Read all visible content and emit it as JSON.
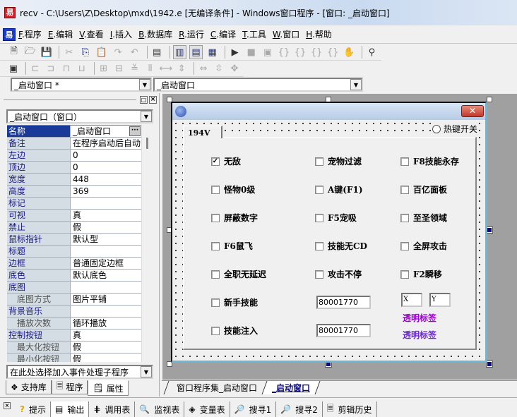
{
  "window": {
    "title": "recv - C:\\Users\\Z\\Desktop\\mxd\\1942.e [无编译条件] - Windows窗口程序 - [窗口: _启动窗口]",
    "app_icon": "easy-language-logo"
  },
  "menu": [
    {
      "key": "F",
      "label": ".程序"
    },
    {
      "key": "E",
      "label": ".编辑"
    },
    {
      "key": "V",
      "label": ".查看"
    },
    {
      "key": "I",
      "label": ".插入"
    },
    {
      "key": "B",
      "label": ".数据库"
    },
    {
      "key": "R",
      "label": ".运行"
    },
    {
      "key": "C",
      "label": ".编译"
    },
    {
      "key": "T",
      "label": ".工具"
    },
    {
      "key": "W",
      "label": ".窗口"
    },
    {
      "key": "H",
      "label": ".帮助"
    }
  ],
  "toolbar1": {
    "icons": [
      "new-file",
      "open-folder",
      "save",
      "cut",
      "copy",
      "paste",
      "redo",
      "undo",
      "find-window",
      "layout-1",
      "layout-2",
      "layout-3",
      "run",
      "stop",
      "compile",
      "step-into",
      "step-over",
      "step-out",
      "run-to-cursor",
      "breakpoint-hand",
      "find-binoculars"
    ]
  },
  "toolbar2": {
    "icons": [
      "form-layout",
      "align-left",
      "align-right",
      "align-top",
      "align-bottom",
      "center-horizontal",
      "center-vertical",
      "distribute-top",
      "distribute-left",
      "space-horizontal",
      "space-vertical",
      "same-width",
      "same-height",
      "same-size"
    ]
  },
  "combos": {
    "left": "_启动窗口 *",
    "right": "_启动窗口"
  },
  "left_panel": {
    "object_select": "_启动窗口（窗口）",
    "properties": [
      {
        "name": "名称",
        "value": "_启动窗口",
        "selected": true,
        "ellipsis": true
      },
      {
        "name": "备注",
        "value": "在程序启动后自动"
      },
      {
        "name": "左边",
        "value": "0"
      },
      {
        "name": "顶边",
        "value": "0"
      },
      {
        "name": "宽度",
        "value": "448"
      },
      {
        "name": "高度",
        "value": "369"
      },
      {
        "name": "标记",
        "value": ""
      },
      {
        "name": "可视",
        "value": "真"
      },
      {
        "name": "禁止",
        "value": "假"
      },
      {
        "name": "鼠标指针",
        "value": "默认型"
      },
      {
        "name": "标题",
        "value": ""
      },
      {
        "name": "边框",
        "value": "普通固定边框"
      },
      {
        "name": "底色",
        "value": "默认底色"
      },
      {
        "name": "底图",
        "value": ""
      },
      {
        "name": "底图方式",
        "value": "图片平铺",
        "sub": true
      },
      {
        "name": "背景音乐",
        "value": ""
      },
      {
        "name": "播放次数",
        "value": "循环播放",
        "sub": true
      },
      {
        "name": "控制按钮",
        "value": "真"
      },
      {
        "name": "最大化按钮",
        "value": "假",
        "sub": true
      },
      {
        "name": "最小化按钮",
        "value": "假",
        "sub": true
      }
    ],
    "event_select": "在此处选择加入事件处理子程序",
    "tabs": [
      {
        "label": "支持库",
        "icon": "library-icon"
      },
      {
        "label": "程序",
        "icon": "program-icon"
      },
      {
        "label": "属性",
        "icon": "property-icon",
        "active": true
      }
    ]
  },
  "form": {
    "tab_label": "194V",
    "hotkey_radio": "热键开关",
    "checkboxes": [
      {
        "label": "无敌",
        "checked": true
      },
      {
        "label": "宠物过滤",
        "checked": false
      },
      {
        "label": "F8技能永存",
        "checked": false
      },
      {
        "label": "怪物0级",
        "checked": false
      },
      {
        "label": "A键(F1)",
        "checked": false
      },
      {
        "label": "百亿面板",
        "checked": false
      },
      {
        "label": "屏蔽数字",
        "checked": false
      },
      {
        "label": "F5宠吸",
        "checked": false
      },
      {
        "label": "至圣领域",
        "checked": false
      },
      {
        "label": "F6鼠飞",
        "checked": false
      },
      {
        "label": "技能无CD",
        "checked": false
      },
      {
        "label": "全屏攻击",
        "checked": false
      },
      {
        "label": "全职无延迟",
        "checked": false
      },
      {
        "label": "攻击不停",
        "checked": false
      },
      {
        "label": "F2瞬移",
        "checked": false
      },
      {
        "label": "新手技能",
        "checked": false
      },
      {
        "label": "技能注入",
        "checked": false
      }
    ],
    "inputs": {
      "addr1": "80001770",
      "addr2": "80001770",
      "x": "X",
      "y": "Y"
    },
    "labels": [
      {
        "text": "透明标签",
        "color": "#9b00d9"
      },
      {
        "text": "透明标签",
        "color": "#6a2bd6"
      }
    ]
  },
  "doc_tabs": [
    {
      "label": "窗口程序集_启动窗口",
      "active": false
    },
    {
      "label": "_启动窗口",
      "active": true
    }
  ],
  "bottom_tabs": [
    {
      "label": "提示",
      "icon": "question-icon"
    },
    {
      "label": "输出",
      "icon": "output-icon"
    },
    {
      "label": "调用表",
      "icon": "callstack-icon"
    },
    {
      "label": "监视表",
      "icon": "magnifier-icon"
    },
    {
      "label": "变量表",
      "icon": "variables-icon"
    },
    {
      "label": "搜寻1",
      "icon": "search-doc-icon"
    },
    {
      "label": "搜寻2",
      "icon": "search-doc-icon"
    },
    {
      "label": "剪辑历史",
      "icon": "clipboard-history-icon"
    }
  ]
}
